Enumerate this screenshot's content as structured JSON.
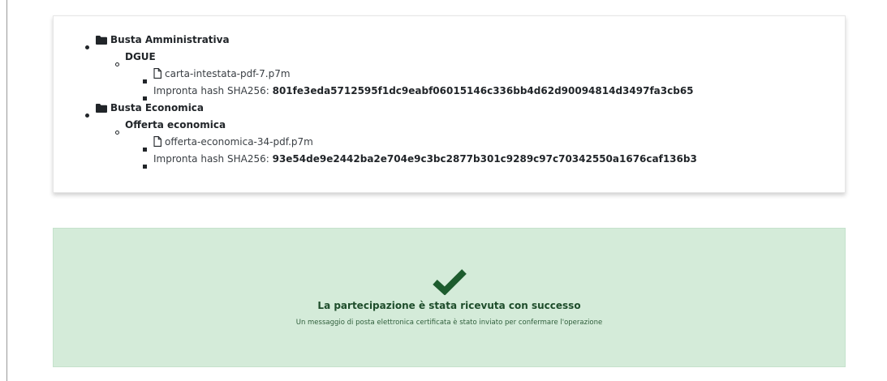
{
  "tree": {
    "envelopes": [
      {
        "name": "Busta Amministrativa",
        "document": "DGUE",
        "file": "carta-intestata-pdf-7.p7m",
        "hash_label": "Impronta hash SHA256:",
        "hash_value": "801fe3eda5712595f1dc9eabf06015146c336bb4d62d90094814d3497fa3cb65"
      },
      {
        "name": "Busta Economica",
        "document": "Offerta economica",
        "file": "offerta-economica-34-pdf.p7m",
        "hash_label": "Impronta hash SHA256:",
        "hash_value": "93e54de9e2442ba2e704e9c3bc2877b301c9289c97c70342550a1676caf136b3"
      }
    ]
  },
  "success": {
    "icon": "check-icon",
    "title": "La partecipazione è stata ricevuta con successo",
    "subtitle": "Un messaggio di posta elettronica certificata è stato inviato per confermare l'operazione"
  },
  "colors": {
    "success_bg": "#d4ebd9",
    "success_text": "#1e4d2b",
    "check": "#1d5c2e"
  }
}
